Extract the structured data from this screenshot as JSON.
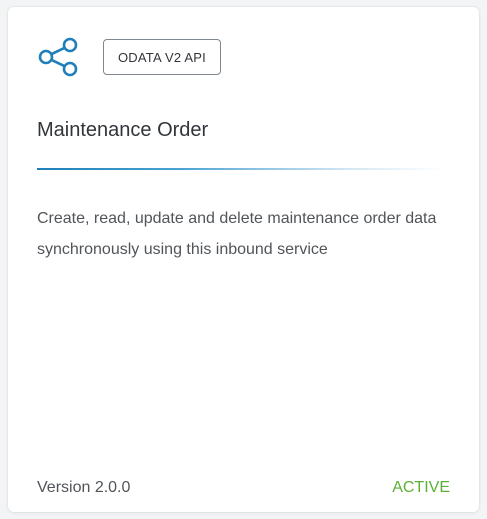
{
  "card": {
    "icon": "share-network-icon",
    "badge": "ODATA V2 API",
    "title": "Maintenance Order",
    "description": "Create, read, update and delete maintenance order data synchronously using this inbound service",
    "version": "Version 2.0.0",
    "status": "ACTIVE"
  },
  "colors": {
    "accent": "#1f7fb8",
    "status_active": "#5bb035",
    "text": "#32363a"
  }
}
